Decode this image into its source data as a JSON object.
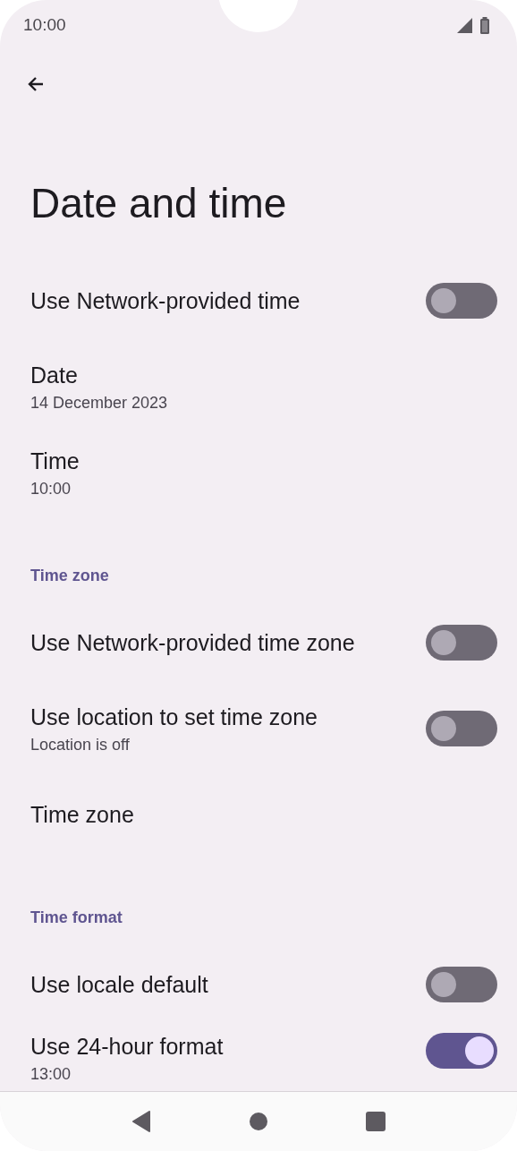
{
  "status_bar": {
    "time": "10:00"
  },
  "title": "Date and time",
  "items": [
    {
      "kind": "toggle",
      "title": "Use Network-provided time",
      "on": false
    },
    {
      "kind": "text",
      "title": "Date",
      "summary": "14 December 2023"
    },
    {
      "kind": "text",
      "title": "Time",
      "summary": "10:00"
    },
    {
      "kind": "header",
      "title": "Time zone"
    },
    {
      "kind": "toggle",
      "title": "Use Network-provided time zone",
      "on": false
    },
    {
      "kind": "toggle",
      "title": "Use location to set time zone",
      "summary": "Location is off",
      "on": false
    },
    {
      "kind": "text",
      "title": "Time zone"
    },
    {
      "kind": "header",
      "title": "Time format"
    },
    {
      "kind": "toggle",
      "title": "Use locale default",
      "on": false
    },
    {
      "kind": "toggle",
      "title": "Use 24-hour format",
      "summary": "13:00",
      "on": true
    }
  ]
}
